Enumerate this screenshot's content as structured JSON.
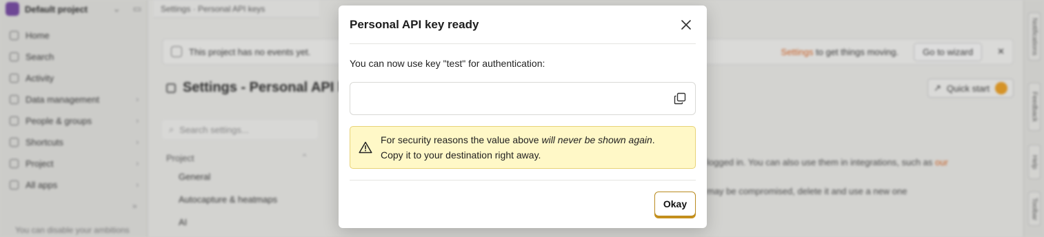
{
  "background": {
    "sidebar": {
      "project_name": "Default project",
      "items": [
        {
          "label": "Home",
          "expandable": false
        },
        {
          "label": "Search",
          "expandable": false
        },
        {
          "label": "Activity",
          "expandable": false
        },
        {
          "label": "Data management",
          "expandable": true
        },
        {
          "label": "People & groups",
          "expandable": true
        },
        {
          "label": "Shortcuts",
          "expandable": true
        },
        {
          "label": "Project",
          "expandable": true
        },
        {
          "label": "All apps",
          "expandable": true
        }
      ],
      "footer_text": "You can disable your ambitions"
    },
    "tab_title": "Settings · Personal API keys",
    "banner": {
      "text": "This project has no events yet.",
      "link_text": "Settings",
      "trailing_text": "to get things moving.",
      "wizard_label": "Go to wizard"
    },
    "page_title": "Settings - Personal API keys",
    "quick_start_label": "Quick start",
    "search_placeholder": "Search settings...",
    "settings_nav": {
      "section": "Project",
      "items": [
        "General",
        "Autocapture & heatmaps",
        "AI"
      ]
    },
    "content_lines": [
      {
        "text": "logged in. You can also use them in integrations, such as ",
        "link": "our"
      },
      {
        "text": "may be compromised, delete it and use a new one",
        "link": ""
      }
    ],
    "right_rail": [
      "Notifications",
      "Feedback",
      "Help",
      "Toolbar"
    ]
  },
  "modal": {
    "title": "Personal API key ready",
    "description": "You can now use key \"test\" for authentication:",
    "key_value": "",
    "warning": {
      "before": "For security reasons the value above ",
      "emphasis": "will never be shown again",
      "after": ".",
      "line2": "Copy it to your destination right away."
    },
    "ok_label": "Okay"
  },
  "colors": {
    "warning_bg": "#fff8c7",
    "warning_border": "#e8d277",
    "primary_button_border": "#b98a1e",
    "brand_orange": "#e06b2a"
  }
}
